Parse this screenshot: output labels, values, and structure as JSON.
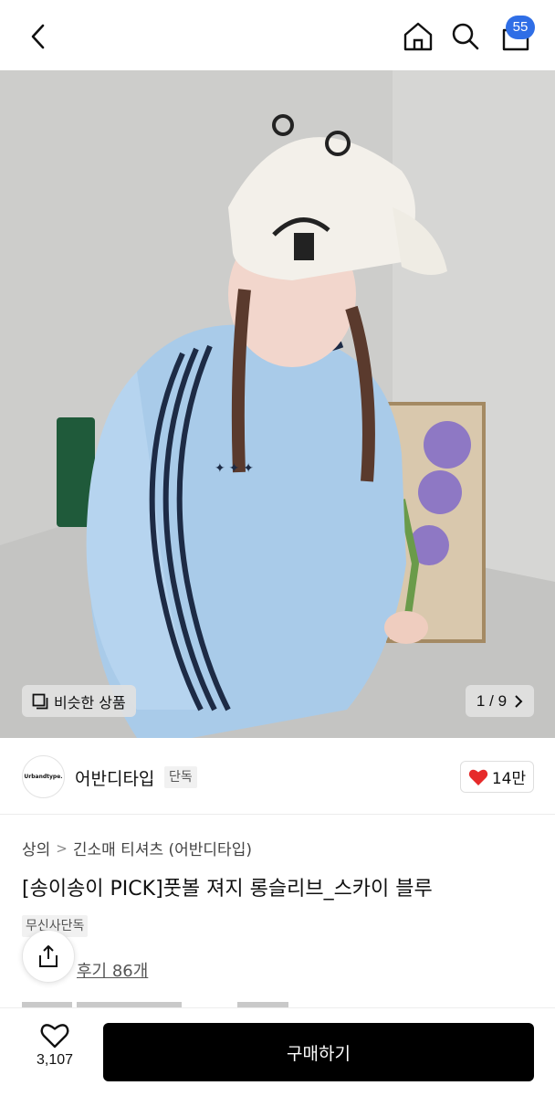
{
  "header": {
    "back_icon": "chevron-left-icon",
    "home_icon": "home-icon",
    "search_icon": "search-icon",
    "cart_icon": "shopping-bag-icon",
    "cart_badge": "55",
    "badge_color": "#2f6ee6"
  },
  "hero": {
    "image_alt": "",
    "similar_label": "비슷한 상품",
    "pager_current": "1",
    "pager_sep": "/",
    "pager_total": "9"
  },
  "brand": {
    "logo_text": "Urbandtype.",
    "name": "어반디타입",
    "tag": "단독",
    "like_count": "14만",
    "like_color": "#e62a2a"
  },
  "product": {
    "breadcrumb": [
      "상의",
      "긴소매 티셔츠 (어반디타입)"
    ],
    "title": "[송이송이 PICK]풋볼 져지 롱슬리브_스카이 블루",
    "exclusive_tag": "무신사단독",
    "reviews": "후기 86개"
  },
  "bottom_bar": {
    "wish_count": "3,107",
    "buy_label": "구매하기"
  }
}
